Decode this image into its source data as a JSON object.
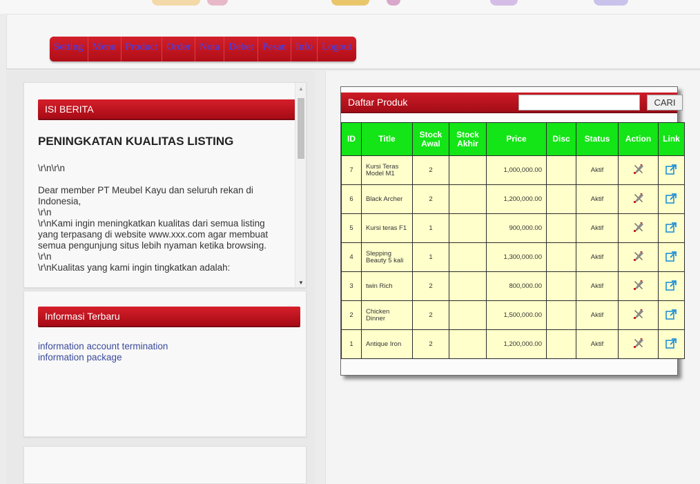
{
  "nav": {
    "items": [
      "Setting",
      "Menu",
      "Product",
      "Order",
      "Nota",
      "Debet",
      "Pesan",
      "Info",
      "Logout"
    ]
  },
  "news": {
    "heading": "ISI BERITA",
    "title": "PENINGKATAN KUALITAS LISTING",
    "lines": [
      "\\r\\n\\r\\n",
      "Dear member PT Meubel Kayu dan seluruh rekan di Indonesia,",
      "\\r\\n",
      "\\r\\nKami ingin meningkatkan kualitas dari semua listing yang terpasang di website www.xxx.com agar membuat semua pengunjung situs lebih nyaman ketika browsing.",
      "\\r\\n",
      "\\r\\nKualitas yang kami ingin tingkatkan adalah:"
    ]
  },
  "info": {
    "heading": "Informasi Terbaru",
    "links": [
      "information account termination",
      "information package"
    ]
  },
  "products": {
    "heading": "Daftar Produk",
    "search_value": "",
    "search_button": "CARI",
    "columns": [
      "ID",
      "Title",
      "Stock Awal",
      "Stock Akhir",
      "Price",
      "Disc",
      "Status",
      "Action",
      "Link"
    ],
    "rows": [
      {
        "id": "7",
        "title": "Kursi Teras Model M1",
        "stock_awal": "2",
        "stock_akhir": "",
        "price": "1,000,000.00",
        "disc": "",
        "status": "Aktif"
      },
      {
        "id": "6",
        "title": "Black Archer",
        "stock_awal": "2",
        "stock_akhir": "",
        "price": "1,200,000.00",
        "disc": "",
        "status": "Aktif"
      },
      {
        "id": "5",
        "title": "Kursi teras F1",
        "stock_awal": "1",
        "stock_akhir": "",
        "price": "900,000.00",
        "disc": "",
        "status": "Aktif"
      },
      {
        "id": "4",
        "title": "Slepping Beauty 5 kali",
        "stock_awal": "1",
        "stock_akhir": "",
        "price": "1,300,000.00",
        "disc": "",
        "status": "Aktif"
      },
      {
        "id": "3",
        "title": "twin Rich",
        "stock_awal": "2",
        "stock_akhir": "",
        "price": "800,000.00",
        "disc": "",
        "status": "Aktif"
      },
      {
        "id": "2",
        "title": "Chicken Dinner",
        "stock_awal": "2",
        "stock_akhir": "",
        "price": "1,500,000.00",
        "disc": "",
        "status": "Aktif"
      },
      {
        "id": "1",
        "title": "Antique Iron",
        "stock_awal": "2",
        "stock_akhir": "",
        "price": "1,200,000.00",
        "disc": "",
        "status": "Aktif"
      }
    ],
    "action_icon": "tools-icon",
    "link_icon": "external-link-icon"
  },
  "colors": {
    "header_red": "#b5111c",
    "nav_text": "#3d44ff",
    "table_header_green": "#13e516",
    "table_cell_yellow": "#ffffcc",
    "link_blue": "#3a4a9a"
  }
}
